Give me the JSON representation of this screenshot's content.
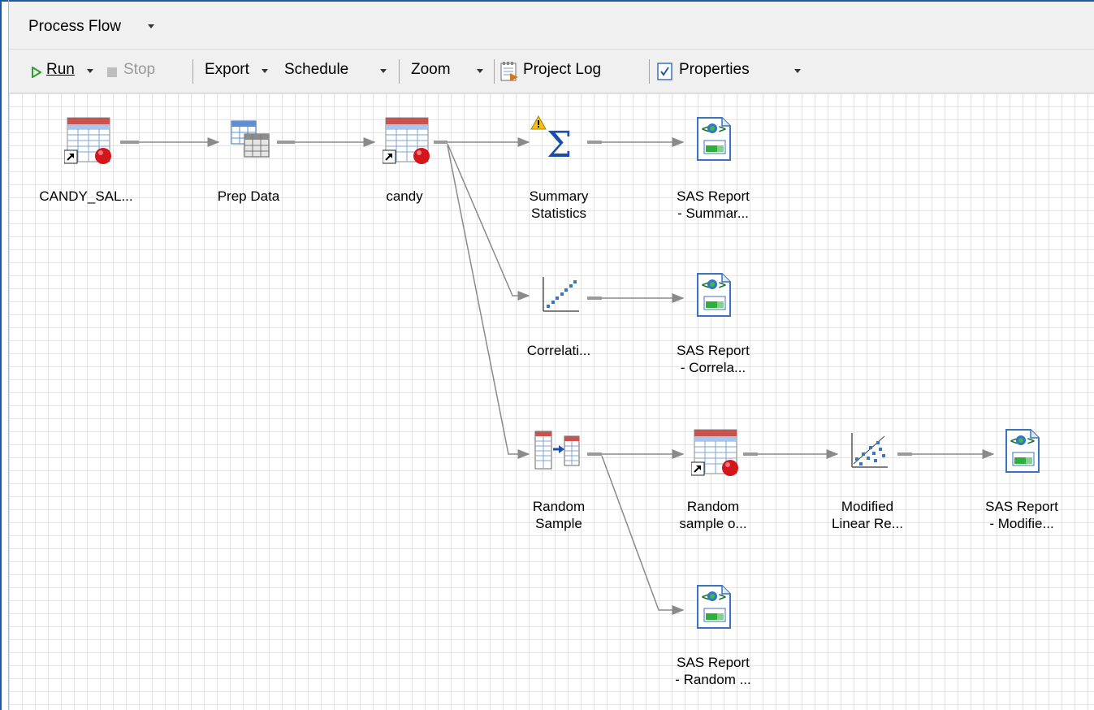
{
  "window": {
    "title": "Process Flow"
  },
  "toolbar": {
    "run": "Run",
    "stop": "Stop",
    "export": "Export",
    "schedule": "Schedule",
    "zoom": "Zoom",
    "project_log": "Project Log",
    "properties": "Properties"
  },
  "nodes": {
    "candy_sales": {
      "icon": "data-table-icon",
      "label": "CANDY_SAL..."
    },
    "prep_data": {
      "icon": "query-builder-icon",
      "label": "Prep Data"
    },
    "candy": {
      "icon": "data-table-icon",
      "label": "candy"
    },
    "summary_stats": {
      "icon": "sigma-warning-icon",
      "label_1": "Summary",
      "label_2": "Statistics"
    },
    "report_summary": {
      "icon": "sas-report-icon",
      "label_1": "SAS Report",
      "label_2": "- Summar..."
    },
    "correlations": {
      "icon": "correlation-icon",
      "label": "Correlati..."
    },
    "report_correlations": {
      "icon": "sas-report-icon",
      "label_1": "SAS Report",
      "label_2": "- Correla..."
    },
    "random_sample": {
      "icon": "random-sample-icon",
      "label_1": "Random",
      "label_2": "Sample"
    },
    "random_sample_output": {
      "icon": "data-table-icon",
      "label_1": "Random",
      "label_2": "sample o..."
    },
    "modified_linear": {
      "icon": "regression-icon",
      "label_1": "Modified",
      "label_2": "Linear Re..."
    },
    "report_modified": {
      "icon": "sas-report-icon",
      "label_1": "SAS Report",
      "label_2": "- Modifie..."
    },
    "report_random": {
      "icon": "sas-report-icon",
      "label_1": "SAS Report",
      "label_2": "- Random ..."
    }
  },
  "colors": {
    "accent": "#1f5aa0",
    "connector": "#808080",
    "run_green": "#2e9e2e"
  }
}
